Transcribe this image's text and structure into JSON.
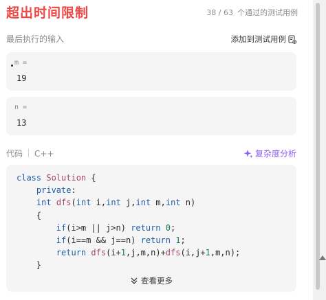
{
  "header": {
    "title": "超出时间限制",
    "passed_count": "38 / 63",
    "passed_label": "个通过的测试用例"
  },
  "last_input": {
    "label": "最后执行的输入",
    "add_testcase_label": "添加到测试用例",
    "params": [
      {
        "name": "m =",
        "value": "19"
      },
      {
        "name": "n =",
        "value": "13"
      }
    ]
  },
  "code_section": {
    "label": "代码",
    "language": "C++",
    "analyze_label": "复杂度分析",
    "see_more_label": "查看更多",
    "lines": [
      "class Solution {",
      "    private:",
      "    int dfs(int i,int j,int m,int n)",
      "    {",
      "        if(i>m || j>n) return 0;",
      "        if(i==m && j==n) return 1;",
      "        return dfs(i+1,j,m,n)+dfs(i,j+1,m,n);",
      "    }"
    ]
  },
  "colors": {
    "error_red": "#ef4743",
    "accent_purple": "#8b5cf6",
    "panel_bg": "#f5f5f6"
  },
  "icons": [
    "copy-add-icon",
    "sparkle-icon",
    "chevron-double-down-icon"
  ]
}
